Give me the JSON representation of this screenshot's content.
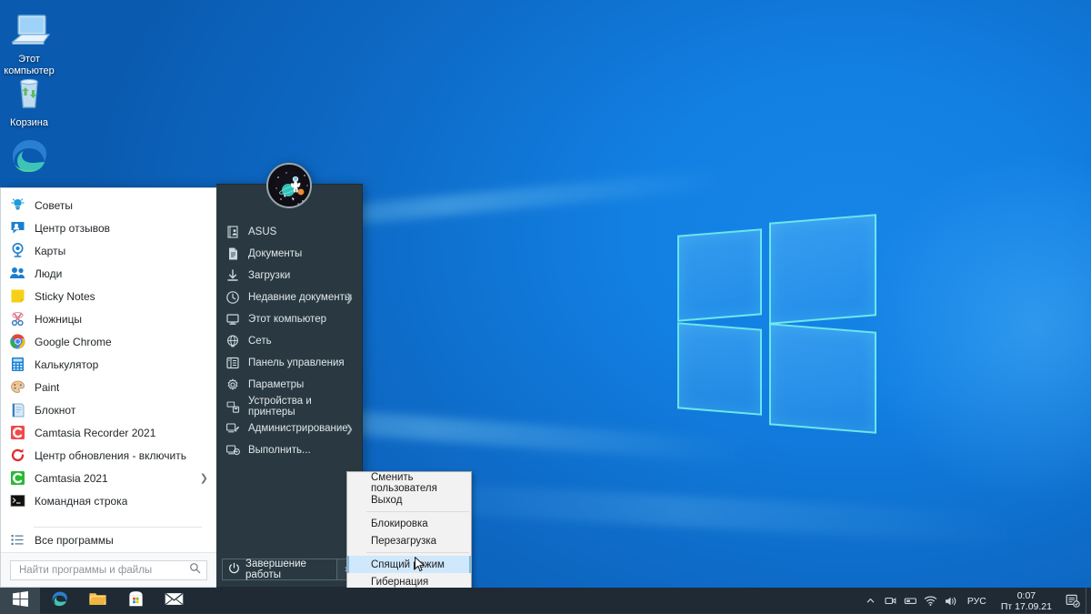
{
  "desktop": {
    "icons": [
      {
        "name": "this-pc",
        "label": "Этот компьютер",
        "icon": "computer-icon"
      },
      {
        "name": "recycle-bin",
        "label": "Корзина",
        "icon": "recycle-bin-icon"
      },
      {
        "name": "microsoft-edge",
        "label": "",
        "icon": "edge-icon"
      }
    ],
    "wallpaper": "windows-10-hero-light"
  },
  "start_menu": {
    "left_panel": {
      "programs": [
        {
          "label": "Советы",
          "icon": "lightbulb-icon",
          "submenu": false
        },
        {
          "label": "Центр отзывов",
          "icon": "feedback-hub-icon",
          "submenu": false
        },
        {
          "label": "Карты",
          "icon": "maps-icon",
          "submenu": false
        },
        {
          "label": "Люди",
          "icon": "people-icon",
          "submenu": false
        },
        {
          "label": "Sticky Notes",
          "icon": "sticky-notes-icon",
          "submenu": false
        },
        {
          "label": "Ножницы",
          "icon": "snipping-tool-icon",
          "submenu": false
        },
        {
          "label": "Google Chrome",
          "icon": "chrome-icon",
          "submenu": false
        },
        {
          "label": "Калькулятор",
          "icon": "calculator-icon",
          "submenu": false
        },
        {
          "label": "Paint",
          "icon": "paint-icon",
          "submenu": false
        },
        {
          "label": "Блокнот",
          "icon": "notepad-icon",
          "submenu": false
        },
        {
          "label": "Camtasia Recorder 2021",
          "icon": "camtasia-recorder-icon",
          "submenu": false
        },
        {
          "label": "Центр обновления - включить",
          "icon": "update-icon",
          "submenu": false
        },
        {
          "label": "Camtasia 2021",
          "icon": "camtasia-icon",
          "submenu": true
        },
        {
          "label": "Командная строка",
          "icon": "command-prompt-icon",
          "submenu": false
        }
      ],
      "all_programs": {
        "label": "Все программы",
        "icon": "all-programs-icon"
      },
      "search": {
        "placeholder": "Найти программы и файлы",
        "value": "",
        "icon": "search-icon"
      }
    },
    "right_panel": {
      "avatar": "astronaut-space-avatar",
      "items": [
        {
          "label": "ASUS",
          "icon": "user-folder-icon",
          "submenu": false
        },
        {
          "label": "Документы",
          "icon": "documents-icon",
          "submenu": false
        },
        {
          "label": "Загрузки",
          "icon": "downloads-icon",
          "submenu": false
        },
        {
          "label": "Недавние документы",
          "icon": "recent-clock-icon",
          "submenu": true
        },
        {
          "label": "Этот компьютер",
          "icon": "this-pc-icon",
          "submenu": false
        },
        {
          "label": "Сеть",
          "icon": "network-icon",
          "submenu": false
        },
        {
          "label": "Панель управления",
          "icon": "control-panel-icon",
          "submenu": false
        },
        {
          "label": "Параметры",
          "icon": "settings-gear-icon",
          "submenu": false
        },
        {
          "label": "Устройства и принтеры",
          "icon": "devices-printers-icon",
          "submenu": false
        },
        {
          "label": "Администрирование",
          "icon": "admin-tools-icon",
          "submenu": true
        },
        {
          "label": "Выполнить...",
          "icon": "run-icon",
          "submenu": false
        }
      ],
      "power": {
        "label": "Завершение работы",
        "icon": "power-icon",
        "arrow": "›"
      }
    }
  },
  "power_menu": {
    "groups": [
      [
        {
          "label": "Сменить пользователя",
          "selected": false
        },
        {
          "label": "Выход",
          "selected": false
        }
      ],
      [
        {
          "label": "Блокировка",
          "selected": false
        },
        {
          "label": "Перезагрузка",
          "selected": false
        }
      ],
      [
        {
          "label": "Спящий режим",
          "selected": true
        },
        {
          "label": "Гибернация",
          "selected": false
        }
      ]
    ]
  },
  "taskbar": {
    "start_button": {
      "name": "start-button",
      "icon": "windows-logo-icon"
    },
    "apps": [
      {
        "label": "Microsoft Edge",
        "icon": "edge-icon"
      },
      {
        "label": "Проводник",
        "icon": "file-explorer-icon"
      },
      {
        "label": "Microsoft Store",
        "icon": "microsoft-store-icon"
      },
      {
        "label": "Почта",
        "icon": "mail-icon"
      }
    ],
    "tray": {
      "overflow": {
        "icon": "chevron-up-icon"
      },
      "icons": [
        {
          "icon": "camera-privacy-icon"
        },
        {
          "icon": "removable-device-icon"
        },
        {
          "icon": "wifi-icon"
        },
        {
          "icon": "volume-icon"
        }
      ],
      "language": "РУС",
      "clock": {
        "time": "0:07",
        "date": "Пт 17.09.21"
      },
      "action_center": {
        "icon": "action-center-icon"
      }
    }
  },
  "colors": {
    "desktop_blue": "#0f6fcc",
    "taskbar": "#1f2a34",
    "start_right_panel": "#2a3941",
    "start_left_panel": "#ffffff",
    "menu_selection": "#cfe8fb",
    "accent_blue": "#0078d7"
  }
}
